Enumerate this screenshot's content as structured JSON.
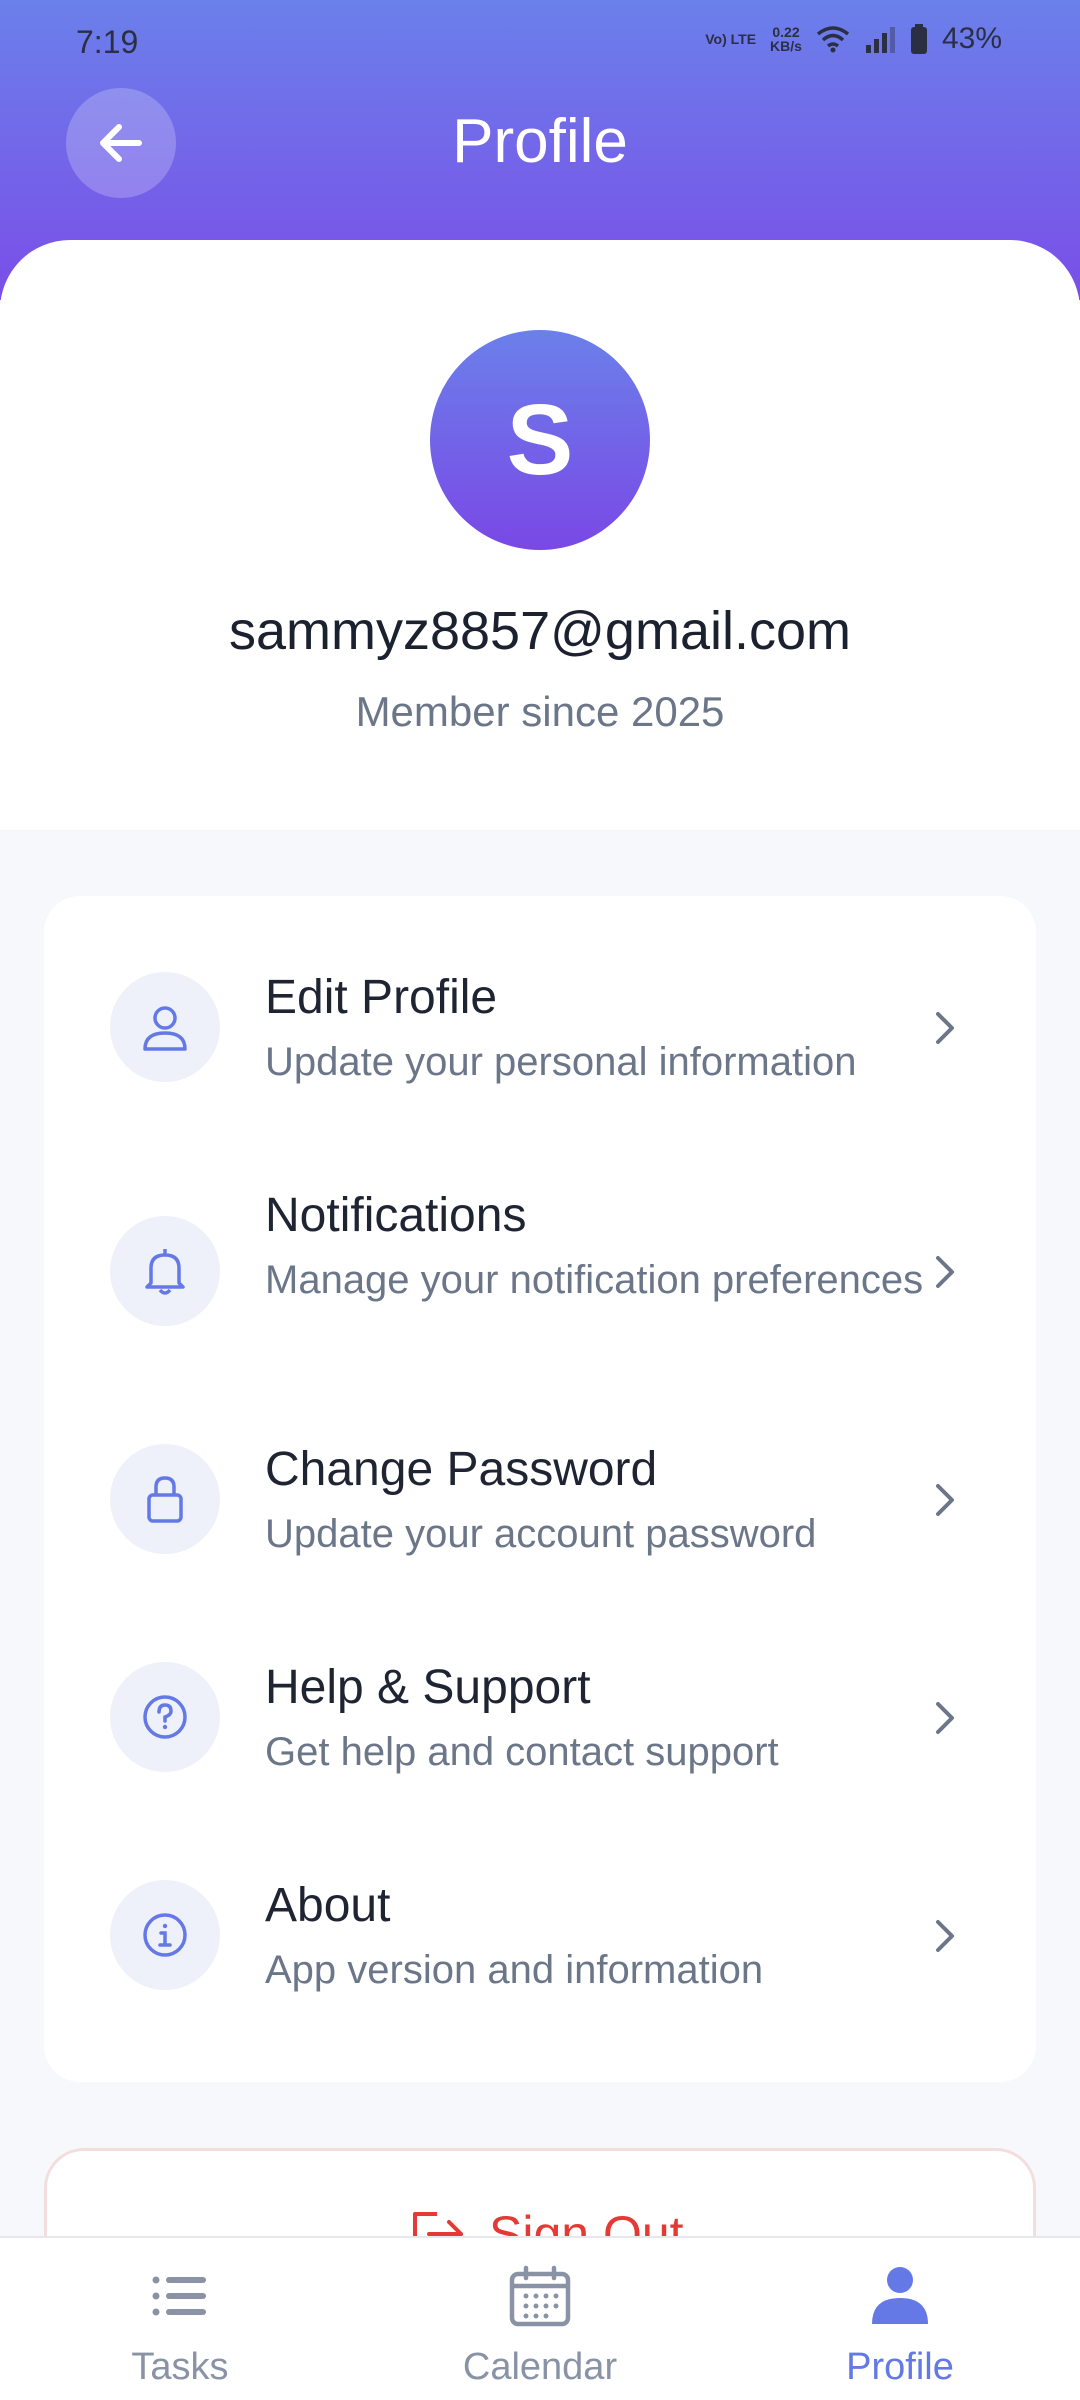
{
  "status_bar": {
    "time": "7:19",
    "network_label": "Vo) LTE",
    "speed": "0.22",
    "speed_unit": "KB/s",
    "battery": "43%"
  },
  "header": {
    "title": "Profile",
    "back_icon": "arrow-left-icon"
  },
  "profile": {
    "initial": "S",
    "email": "sammyz8857@gmail.com",
    "member_since": "Member since 2025"
  },
  "menu": [
    {
      "title": "Edit Profile",
      "subtitle": "Update your personal information",
      "icon": "user-icon"
    },
    {
      "title": "Notifications",
      "subtitle": "Manage your notification preferences",
      "icon": "bell-icon"
    },
    {
      "title": "Change Password",
      "subtitle": "Update your account password",
      "icon": "lock-icon"
    },
    {
      "title": "Help & Support",
      "subtitle": "Get help and contact support",
      "icon": "help-circle-icon"
    },
    {
      "title": "About",
      "subtitle": "App version and information",
      "icon": "info-icon"
    }
  ],
  "sign_out": {
    "label": "Sign Out",
    "color": "#e53935"
  },
  "bottom_nav": [
    {
      "label": "Tasks",
      "icon": "list-icon",
      "active": false
    },
    {
      "label": "Calendar",
      "icon": "calendar-icon",
      "active": false
    },
    {
      "label": "Profile",
      "icon": "person-icon",
      "active": true
    }
  ],
  "colors": {
    "accent": "#6479e6",
    "gradient_start": "#6b80ea",
    "gradient_end": "#7a4ee8"
  }
}
